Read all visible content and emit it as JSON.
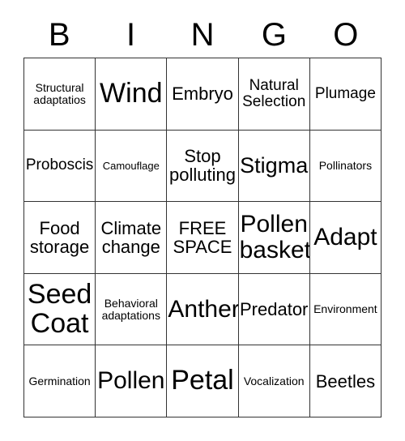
{
  "card": {
    "type": "bingo-card",
    "grid_size": 5,
    "free_space_index": 12,
    "header_letters": [
      "B",
      "I",
      "N",
      "G",
      "O"
    ],
    "colors": {
      "background": "#ffffff",
      "text": "#000000",
      "grid_line": "#333333"
    },
    "rows": [
      [
        {
          "text": "Structural\nadaptatios",
          "size": "sm"
        },
        {
          "text": "Wind",
          "size": "3xl"
        },
        {
          "text": "Embryo",
          "size": "lg"
        },
        {
          "text": "Natural\nSelection",
          "size": "md"
        },
        {
          "text": "Plumage",
          "size": "md"
        }
      ],
      [
        {
          "text": "Proboscis",
          "size": "md"
        },
        {
          "text": "Camouflage",
          "size": "xs"
        },
        {
          "text": "Stop\npolluting",
          "size": "lg"
        },
        {
          "text": "Stigma",
          "size": "xl"
        },
        {
          "text": "Pollinators",
          "size": "sm"
        }
      ],
      [
        {
          "text": "Food\nstorage",
          "size": "lg"
        },
        {
          "text": "Climate\nchange",
          "size": "lg"
        },
        {
          "text": "FREE\nSPACE",
          "size": "lg"
        },
        {
          "text": "Pollen\nbasket",
          "size": "2xl"
        },
        {
          "text": "Adapt",
          "size": "2xl"
        }
      ],
      [
        {
          "text": "Seed\nCoat",
          "size": "3xl"
        },
        {
          "text": "Behavioral\nadaptations",
          "size": "sm"
        },
        {
          "text": "Anther",
          "size": "2xl"
        },
        {
          "text": "Predator",
          "size": "lg"
        },
        {
          "text": "Environment",
          "size": "sm"
        }
      ],
      [
        {
          "text": "Germination",
          "size": "sm"
        },
        {
          "text": "Pollen",
          "size": "2xl"
        },
        {
          "text": "Petal",
          "size": "3xl"
        },
        {
          "text": "Vocalization",
          "size": "sm"
        },
        {
          "text": "Beetles",
          "size": "lg"
        }
      ]
    ]
  }
}
